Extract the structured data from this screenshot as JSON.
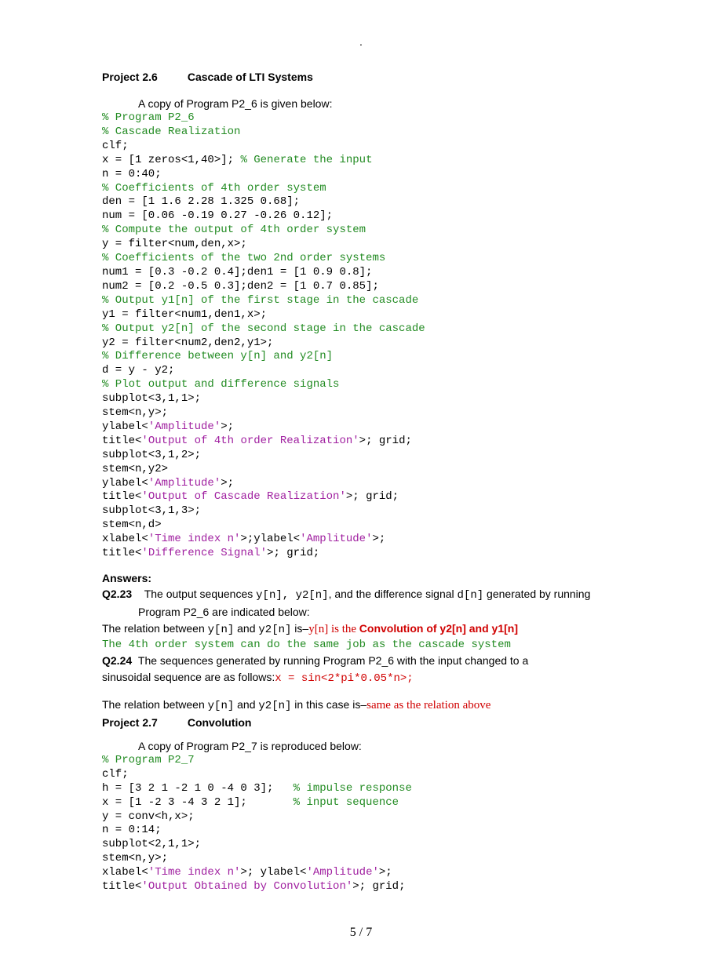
{
  "top_dot": ".",
  "project26": {
    "num": "Project 2.6",
    "title": "Cascade of LTI Systems",
    "intro": "A copy of Program P2_6 is given below:"
  },
  "code1": {
    "l01a": "% Program P2_6",
    "l02a": "% Cascade Realization",
    "l03": "clf;",
    "l04a": "x = [1 zeros<1,40>]; ",
    "l04b": "% Generate the input",
    "l05": "n = 0:40;",
    "l06a": "% Coefficients of 4th order system",
    "l07": "den = [1 1.6 2.28 1.325 0.68];",
    "l08": "num = [0.06 -0.19 0.27 -0.26 0.12];",
    "l09a": "% Compute the output of 4th order system",
    "l10": "y = filter<num,den,x>;",
    "l11a": "% Coefficients of the two 2nd order systems",
    "l12": "num1 = [0.3 -0.2 0.4];den1 = [1 0.9 0.8];",
    "l13": "num2 = [0.2 -0.5 0.3];den2 = [1 0.7 0.85];",
    "l14a": "% Output y1[n] of the first stage in the cascade",
    "l15": "y1 = filter<num1,den1,x>;",
    "l16a": "% Output y2[n] of the second stage in the cascade",
    "l17": "y2 = filter<num2,den2,y1>;",
    "l18a": "% Difference between y[n] and y2[n]",
    "l19": "d = y - y2;",
    "l20a": "% Plot output and difference signals",
    "l21": "subplot<3,1,1>;",
    "l22": "stem<n,y>;",
    "l23a": "ylabel<",
    "l23b": "'Amplitude'",
    "l23c": ">;",
    "l24a": "title<",
    "l24b": "'Output of 4th order Realization'",
    "l24c": ">; grid;",
    "l25": "subplot<3,1,2>;",
    "l26": "stem<n,y2>",
    "l27a": "ylabel<",
    "l27b": "'Amplitude'",
    "l27c": ">;",
    "l28a": "title<",
    "l28b": "'Output of Cascade Realization'",
    "l28c": ">; grid;",
    "l29": "subplot<3,1,3>;",
    "l30": "stem<n,d>",
    "l31a": "xlabel<",
    "l31b": "'Time index n'",
    "l31c": ">;ylabel<",
    "l31d": "'Amplitude'",
    "l31e": ">;",
    "l32a": "title<",
    "l32b": "'Difference Signal'",
    "l32c": ">; grid;"
  },
  "answers_label": "Answers:",
  "q223": {
    "num": "Q2.23",
    "p1": "The output sequences ",
    "yn": "y[n]",
    "comma": ", ",
    "y2n": "y2[n]",
    "p2": ", and the difference signal   ",
    "dn": "d[n]",
    "p3": " generated by running",
    "p4": "Program P2_6 are indicated below:",
    "rel1a": "The relation between ",
    "rel_yn": "y[n]",
    "rel_mid": "  and ",
    "rel_y2n": "y2[n]",
    "rel1b": " is–",
    "red_phrase1": "y[n] is the ",
    "red_phrase2": "Convolution of y2[n] and y1[n]",
    "ord4": "The 4th order system can do the same job as the cascade system"
  },
  "q224": {
    "num": "Q2.24",
    "p1": "The sequences generated by running Program P2_6 with the input changed to a",
    "p2": "sinusoidal sequence are as follows:",
    "sin": "x = sin<2*pi*0.05*n>;",
    "rel1a": "The relation between ",
    "rel_yn": "y[n]",
    "rel_mid": "  and ",
    "rel_y2n": "y2[n]",
    "rel1b": " in this case is–",
    "red": "same as the relation above"
  },
  "project27": {
    "num": "Project 2.7",
    "title": "Convolution",
    "intro": "A copy of Program P2_7 is reproduced below:"
  },
  "code2": {
    "l01a": "% Program P2_7",
    "l02": "clf;",
    "l03a": "h = [3 2 1 -2 1 0 -4 0 3];   ",
    "l03b": "% impulse response",
    "l04a": "x = [1 -2 3 -4 3 2 1];       ",
    "l04b": "% input sequence",
    "l05": "y = conv<h,x>;",
    "l06": "n = 0:14;",
    "l07": "subplot<2,1,1>;",
    "l08": "stem<n,y>;",
    "l09a": "xlabel<",
    "l09b": "'Time index n'",
    "l09c": ">; ylabel<",
    "l09d": "'Amplitude'",
    "l09e": ">;",
    "l10a": "title<",
    "l10b": "'Output Obtained by Convolution'",
    "l10c": ">; grid;"
  },
  "page_num": "5 / 7"
}
